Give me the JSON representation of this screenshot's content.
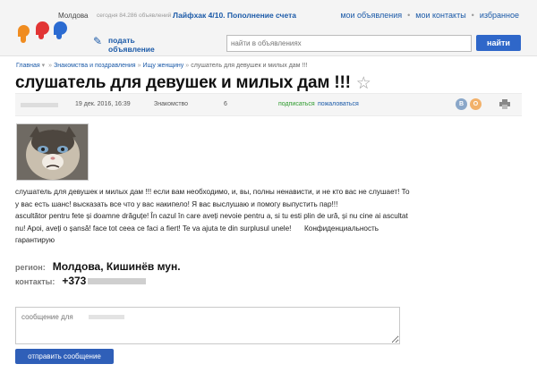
{
  "header": {
    "region": "Молдова",
    "today_count": "сегодня 84.286 объявлений",
    "promo": "Лайфхак 4/10. Пополнение счета",
    "links": [
      "мои объявления",
      "мои контакты",
      "избранное"
    ],
    "post_ad_label": "подать объявление",
    "search_placeholder": "найти в объявлениях",
    "search_button": "найти"
  },
  "breadcrumb": [
    "Главная",
    "Знакомства и поздравления",
    "Ищу женщину",
    "слушатель для девушек и милых дам !!!"
  ],
  "ad": {
    "title": "слушатель для девушек и милых дам !!!",
    "date": "19 дек. 2016, 16:39",
    "category": "Знакомство",
    "views": "6",
    "subscribe": "подписаться",
    "report": "пожаловаться",
    "social": [
      "В",
      "O"
    ],
    "description": [
      " слушатель для девушек и милых дам !!! если вам необходимо, и, вы, полны ненависти, и не кто вас не слушает! То у вас есть шанс!  высказать все что у вас накипело! Я вас выслушаю и помогу выпустить пар!!!",
      "ascultător pentru fete și doamne drăguțe! În cazul în care aveți nevoie pentru a, si tu esti plin de ură, și nu cine ai ascultat nu! Apoi, aveți o șansă!  face tot ceea ce faci a fiert! Te va ajuta te din surplusul unele!",
      "Конфиденциальность гарантирую"
    ],
    "region_label": "регион:",
    "region_value": "Молдова, Кишинёв мун.",
    "contacts_label": "контакты:",
    "contacts_value": "+373"
  },
  "message": {
    "placeholder": "сообщение для",
    "send_button": "отправить сообщение"
  },
  "colors": {
    "accent": "#2f67c9",
    "link": "#1b5aa8",
    "subscribe": "#2c9a2c"
  }
}
